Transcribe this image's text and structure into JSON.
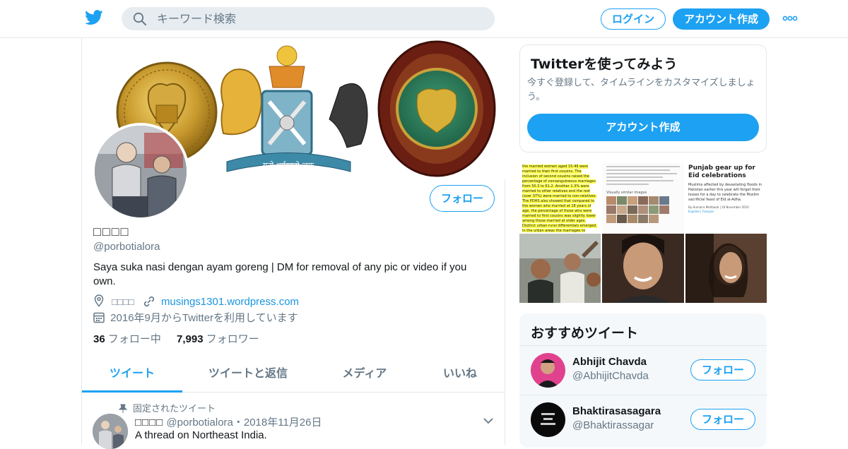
{
  "header": {
    "search_placeholder": "キーワード検索",
    "login_label": "ログイン",
    "signup_label": "アカウント作成",
    "brand_color": "#1da1f2"
  },
  "profile": {
    "display_name": "□□□□",
    "handle": "@porbotialora",
    "bio": "Saya suka nasi dengan ayam goreng | DM for removal of any pic or video if you own.",
    "location": "□□□□",
    "website": "musings1301.wordpress.com",
    "joined": "2016年9月からTwitterを利用しています",
    "following_count": "36",
    "following_label": "フォロー中",
    "followers_count": "7,993",
    "followers_label": "フォロワー",
    "follow_label": "フォロー",
    "banner_motto": "यतो धर्मस्ततो जयः"
  },
  "tabs": [
    {
      "label": "ツイート",
      "active": true
    },
    {
      "label": "ツイートと返信",
      "active": false
    },
    {
      "label": "メディア",
      "active": false
    },
    {
      "label": "いいね",
      "active": false
    }
  ],
  "pinned_tweet": {
    "pinned_label": "固定されたツイート",
    "name": "□□□□",
    "handle_date": "@porbotialora・2018年11月26日",
    "text": "A thread on Northeast India."
  },
  "signup_card": {
    "title": "Twitterを使ってみよう",
    "description": "今すぐ登録して、タイムラインをカスタマイズしましょう。",
    "button_label": "アカウント作成"
  },
  "media_thumbs": {
    "tile1_text": "the married women aged 15-49 were married to their first cousins. The inclusion of second cousins raised the percentage of consanguineous marriages from 50.3 to 61.2. Another 1.3% were married to other relatives and the rest (over 37%) were married to non-relatives. The PDHS also showed that compared to the women who married at 18 years of age, the percentage of those who were married to first cousins was slightly lower among those married at older ages. Distinct urban-rural differentials emerged. In the urban areas the marriages to",
    "tile2_caption": "Visually similar images",
    "tile3_title": "Punjab gear up for Eid celebrations",
    "tile3_body": "Muslims affected by devastating floods in Pakistan earlier this year will forget their losses for a day to celebrate the Muslim sacrificial feast of Eid al-Adha.",
    "tile3_byline": "By Humaira Mehboob | 16 November 2010",
    "tile3_langs": "Español | Français"
  },
  "who_to_follow": {
    "title": "おすすめツイート",
    "follow_label": "フォロー",
    "accounts": [
      {
        "name": "Abhijit Chavda",
        "handle": "@AbhijitChavda"
      },
      {
        "name": "Bhaktirasasagara",
        "handle": "@Bhaktirassagar"
      }
    ]
  }
}
